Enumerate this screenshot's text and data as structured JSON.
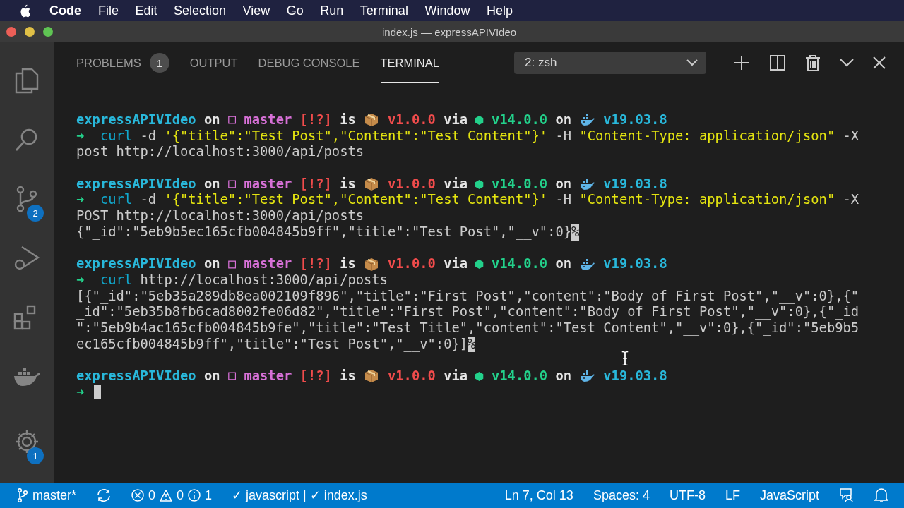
{
  "menubar": {
    "app": "Code",
    "items": [
      "File",
      "Edit",
      "Selection",
      "View",
      "Go",
      "Run",
      "Terminal",
      "Window",
      "Help"
    ]
  },
  "window": {
    "title": "index.js — expressAPIVIdeo"
  },
  "activity_bar": {
    "items": [
      {
        "kind": "files",
        "selected": false
      },
      {
        "kind": "search",
        "selected": false
      },
      {
        "kind": "source-control",
        "selected": false,
        "badge": "2"
      },
      {
        "kind": "run",
        "selected": false
      },
      {
        "kind": "extensions",
        "selected": false
      },
      {
        "kind": "docker",
        "selected": false
      }
    ],
    "manage": {
      "badge": "1"
    }
  },
  "panel": {
    "tabs": [
      {
        "label": "PROBLEMS",
        "selected": false,
        "badge": "1"
      },
      {
        "label": "OUTPUT",
        "selected": false
      },
      {
        "label": "DEBUG CONSOLE",
        "selected": false
      },
      {
        "label": "TERMINAL",
        "selected": true
      }
    ],
    "terminal_select": "2: zsh"
  },
  "terminal": {
    "blocks": [
      {
        "lines": [
          [
            {
              "kind": "dir",
              "text": "expressAPIVIdeo"
            },
            {
              "kind": "plain",
              "text": " on "
            },
            {
              "kind": "branch",
              "text": "master"
            },
            {
              "kind": "status",
              "text": " [!?]"
            },
            {
              "kind": "plain",
              "text": " is "
            },
            {
              "kind": "pkg",
              "text": " v1.0.0"
            },
            {
              "kind": "plain",
              "text": " via "
            },
            {
              "kind": "node",
              "text": "v14.0.0"
            },
            {
              "kind": "plain",
              "text": " on "
            },
            {
              "kind": "docker",
              "text": " v19.03.8"
            }
          ],
          [
            {
              "kind": "arrow",
              "text": "➜"
            },
            {
              "kind": "cmd",
              "text": "  curl"
            },
            {
              "kind": "out",
              "text": " -d "
            },
            {
              "kind": "str",
              "text": "'{\"title\":\"Test Post\",\"Content\":\"Test Content\"}'"
            },
            {
              "kind": "out",
              "text": " -H "
            },
            {
              "kind": "str",
              "text": "\"Content-Type: application/json\""
            },
            {
              "kind": "out",
              "text": " -X"
            }
          ],
          [
            {
              "kind": "out",
              "text": "post http://localhost:3000/api/posts"
            }
          ]
        ]
      },
      {
        "lines": [
          [
            {
              "kind": "dir",
              "text": "expressAPIVIdeo"
            },
            {
              "kind": "plain",
              "text": " on "
            },
            {
              "kind": "branch",
              "text": "master"
            },
            {
              "kind": "status",
              "text": " [!?]"
            },
            {
              "kind": "plain",
              "text": " is "
            },
            {
              "kind": "pkg",
              "text": " v1.0.0"
            },
            {
              "kind": "plain",
              "text": " via "
            },
            {
              "kind": "node",
              "text": "v14.0.0"
            },
            {
              "kind": "plain",
              "text": " on "
            },
            {
              "kind": "docker",
              "text": " v19.03.8"
            }
          ],
          [
            {
              "kind": "arrow",
              "text": "➜"
            },
            {
              "kind": "cmd",
              "text": "  curl"
            },
            {
              "kind": "out",
              "text": " -d "
            },
            {
              "kind": "str",
              "text": "'{\"title\":\"Test Post\",\"Content\":\"Test Content\"}'"
            },
            {
              "kind": "out",
              "text": " -H "
            },
            {
              "kind": "str",
              "text": "\"Content-Type: application/json\""
            },
            {
              "kind": "out",
              "text": " -X"
            }
          ],
          [
            {
              "kind": "out",
              "text": "POST http://localhost:3000/api/posts"
            }
          ],
          [
            {
              "kind": "out",
              "text": "{\"_id\":\"5eb9b5ec165cfb004845b9ff\",\"title\":\"Test Post\",\"__v\":0}"
            },
            {
              "kind": "eol",
              "text": "%"
            }
          ]
        ]
      },
      {
        "lines": [
          [
            {
              "kind": "dir",
              "text": "expressAPIVIdeo"
            },
            {
              "kind": "plain",
              "text": " on "
            },
            {
              "kind": "branch",
              "text": "master"
            },
            {
              "kind": "status",
              "text": " [!?]"
            },
            {
              "kind": "plain",
              "text": " is "
            },
            {
              "kind": "pkg",
              "text": " v1.0.0"
            },
            {
              "kind": "plain",
              "text": " via "
            },
            {
              "kind": "node",
              "text": "v14.0.0"
            },
            {
              "kind": "plain",
              "text": " on "
            },
            {
              "kind": "docker",
              "text": " v19.03.8"
            }
          ],
          [
            {
              "kind": "arrow",
              "text": "➜"
            },
            {
              "kind": "cmd",
              "text": "  curl"
            },
            {
              "kind": "out",
              "text": " http://localhost:3000/api/posts"
            }
          ],
          [
            {
              "kind": "out",
              "text": "[{\"_id\":\"5eb35a289db8ea002109f896\",\"title\":\"First Post\",\"content\":\"Body of First Post\",\"__v\":0},{\""
            }
          ],
          [
            {
              "kind": "out",
              "text": "_id\":\"5eb35b8fb6cad8002fe06d82\",\"title\":\"First Post\",\"content\":\"Body of First Post\",\"__v\":0},{\"_id"
            }
          ],
          [
            {
              "kind": "out",
              "text": "\":\"5eb9b4ac165cfb004845b9fe\",\"title\":\"Test Title\",\"content\":\"Test Content\",\"__v\":0},{\"_id\":\"5eb9b5"
            }
          ],
          [
            {
              "kind": "out",
              "text": "ec165cfb004845b9ff\",\"title\":\"Test Post\",\"__v\":0}]"
            },
            {
              "kind": "eol",
              "text": "%"
            }
          ]
        ]
      },
      {
        "lines": [
          [
            {
              "kind": "dir",
              "text": "expressAPIVIdeo"
            },
            {
              "kind": "plain",
              "text": " on "
            },
            {
              "kind": "branch",
              "text": "master"
            },
            {
              "kind": "status",
              "text": " [!?]"
            },
            {
              "kind": "plain",
              "text": " is "
            },
            {
              "kind": "pkg",
              "text": " v1.0.0"
            },
            {
              "kind": "plain",
              "text": " via "
            },
            {
              "kind": "node",
              "text": "v14.0.0"
            },
            {
              "kind": "plain",
              "text": " on "
            },
            {
              "kind": "docker",
              "text": " v19.03.8"
            }
          ],
          [
            {
              "kind": "arrow",
              "text": "➜"
            },
            {
              "kind": "cursor"
            }
          ]
        ]
      }
    ]
  },
  "status_bar": {
    "branch": "master*",
    "errors": "0",
    "warnings": "0",
    "infos": "1",
    "linters": "✓ javascript | ✓ index.js",
    "right": [
      "Ln 7, Col 13",
      "Spaces: 4",
      "UTF-8",
      "LF",
      "JavaScript"
    ]
  }
}
